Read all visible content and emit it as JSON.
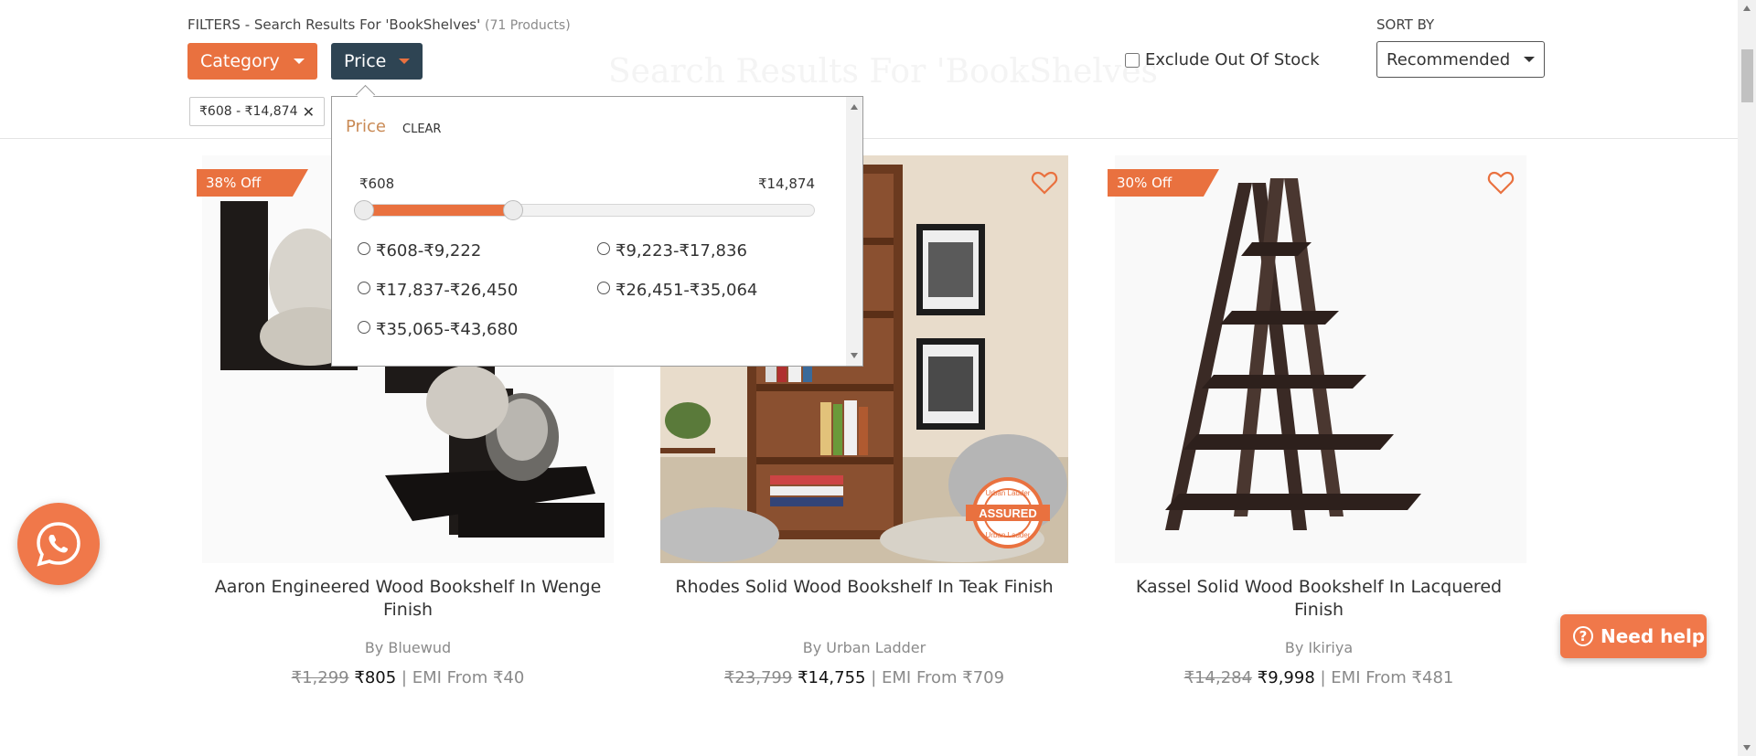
{
  "header": {
    "filters_label": "FILTERS - Search Results For 'BookShelves'",
    "product_count": "(71 Products)",
    "ghost_title": "Search Results For 'BookShelves'",
    "category_label": "Category",
    "price_label": "Price",
    "active_chip": "₹608 - ₹14,874",
    "exclude_label": "Exclude Out Of Stock",
    "exclude_checked": false,
    "sort_label": "SORT BY",
    "sort_value": "Recommended"
  },
  "price_panel": {
    "title": "Price",
    "clear": "CLEAR",
    "min_label": "₹608",
    "max_label": "₹14,874",
    "slider_fill_fraction": 0.34,
    "options": [
      "₹608-₹9,222",
      "₹9,223-₹17,836",
      "₹17,837-₹26,450",
      "₹26,451-₹35,064",
      "₹35,065-₹43,680"
    ]
  },
  "products": [
    {
      "discount": "38% Off",
      "title": "Aaron Engineered Wood Bookshelf In Wenge Finish",
      "brand": "By Bluewud",
      "old_price": "₹1,299",
      "price": "₹805",
      "emi": "| EMI From ₹40"
    },
    {
      "discount": "",
      "title": "Rhodes Solid Wood Bookshelf In Teak Finish",
      "brand": "By Urban Ladder",
      "old_price": "₹23,799",
      "price": "₹14,755",
      "emi": "| EMI From ₹709",
      "assured_badge": "ASSURED",
      "assured_ring": "Urban Ladder"
    },
    {
      "discount": "30% Off",
      "title": "Kassel Solid Wood Bookshelf In Lacquered Finish",
      "brand": "By Ikiriya",
      "old_price": "₹14,284",
      "price": "₹9,998",
      "emi": "| EMI From ₹481"
    }
  ],
  "help_label": "Need help",
  "colors": {
    "accent": "#e9713f",
    "dark": "#2e4453"
  }
}
